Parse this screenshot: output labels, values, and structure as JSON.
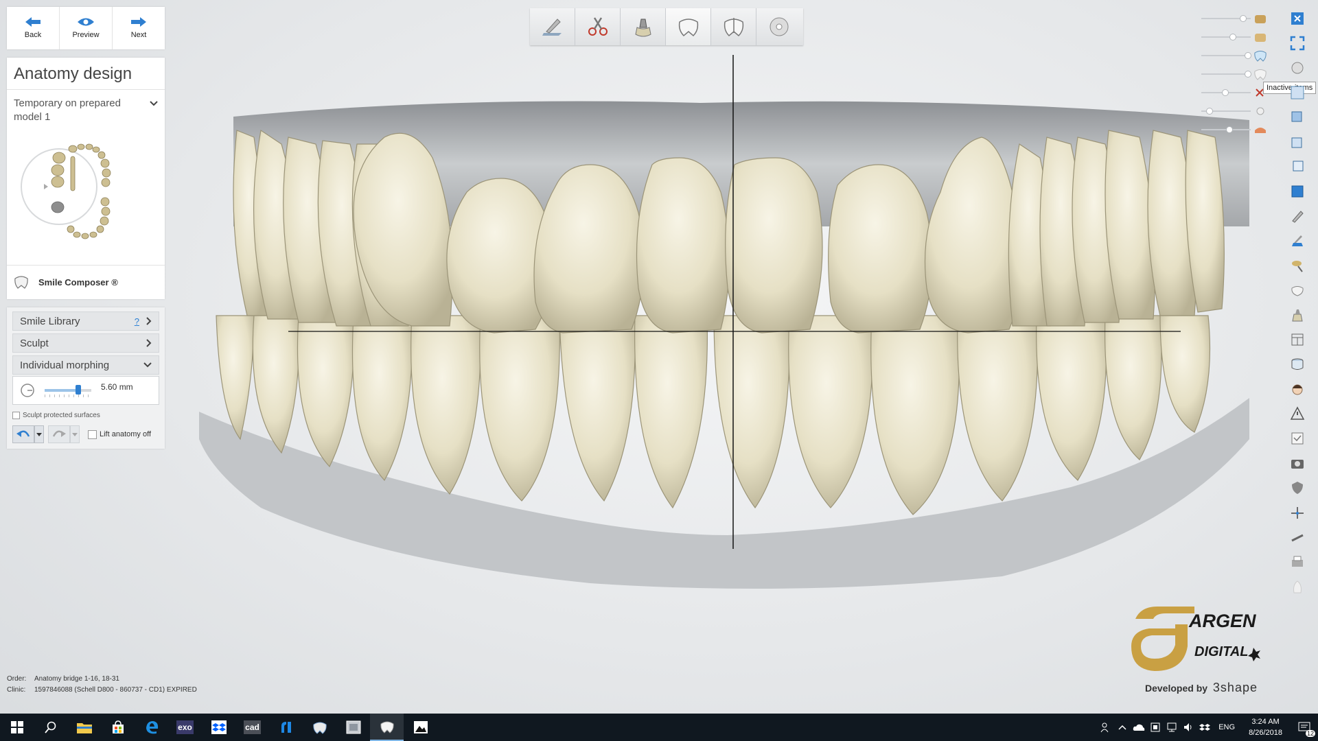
{
  "nav": {
    "back": "Back",
    "preview": "Preview",
    "next": "Next"
  },
  "panel": {
    "title": "Anatomy design",
    "case_line1": "Temporary on prepared",
    "case_line2": "model 1",
    "smile_composer": "Smile Composer ®"
  },
  "tools": {
    "smile_library": "Smile Library",
    "help": "?",
    "sculpt": "Sculpt",
    "individual_morphing": "Individual morphing",
    "morph_value": "5.60 mm",
    "morph_level": 0.72,
    "sculpt_protected": "Sculpt protected surfaces",
    "lift_anatomy": "Lift anatomy off"
  },
  "toolbar_icons": [
    "scan-icon",
    "cut-icon",
    "crown-prep-icon",
    "tooth-icon",
    "tooth-split-icon",
    "cd-icon"
  ],
  "visibility_levels": [
    0.85,
    0.62,
    0.95,
    0.95,
    0.45,
    0.1,
    0.55
  ],
  "tooltip": "Inactive items",
  "order": {
    "order_label": "Order:",
    "order_value": "Anatomy bridge 1-16, 18-31",
    "clinic_label": "Clinic:",
    "clinic_value": "1597846088 (Schell D800 - 860737 - CD1) EXPIRED"
  },
  "logo": {
    "brand": "ARGEN",
    "sub": "DIGITAL",
    "developed": "Developed by",
    "vendor": "3shape"
  },
  "taskbar": {
    "apps": [
      "windows-icon",
      "search-icon",
      "file-explorer-icon",
      "store-icon",
      "edge-icon",
      "exo",
      "dropbox-icon",
      "cad",
      "app-icon",
      "dental-icon",
      "viewer-icon",
      "tooth-app-icon",
      "photos-icon"
    ],
    "lang": "ENG",
    "time": "3:24 AM",
    "date": "8/26/2018",
    "notifications": "12"
  },
  "colors": {
    "accent": "#2f7fd0",
    "tooth": "#ece7cf",
    "gum": "#b8bbbe",
    "logo_gold": "#c9a043"
  }
}
